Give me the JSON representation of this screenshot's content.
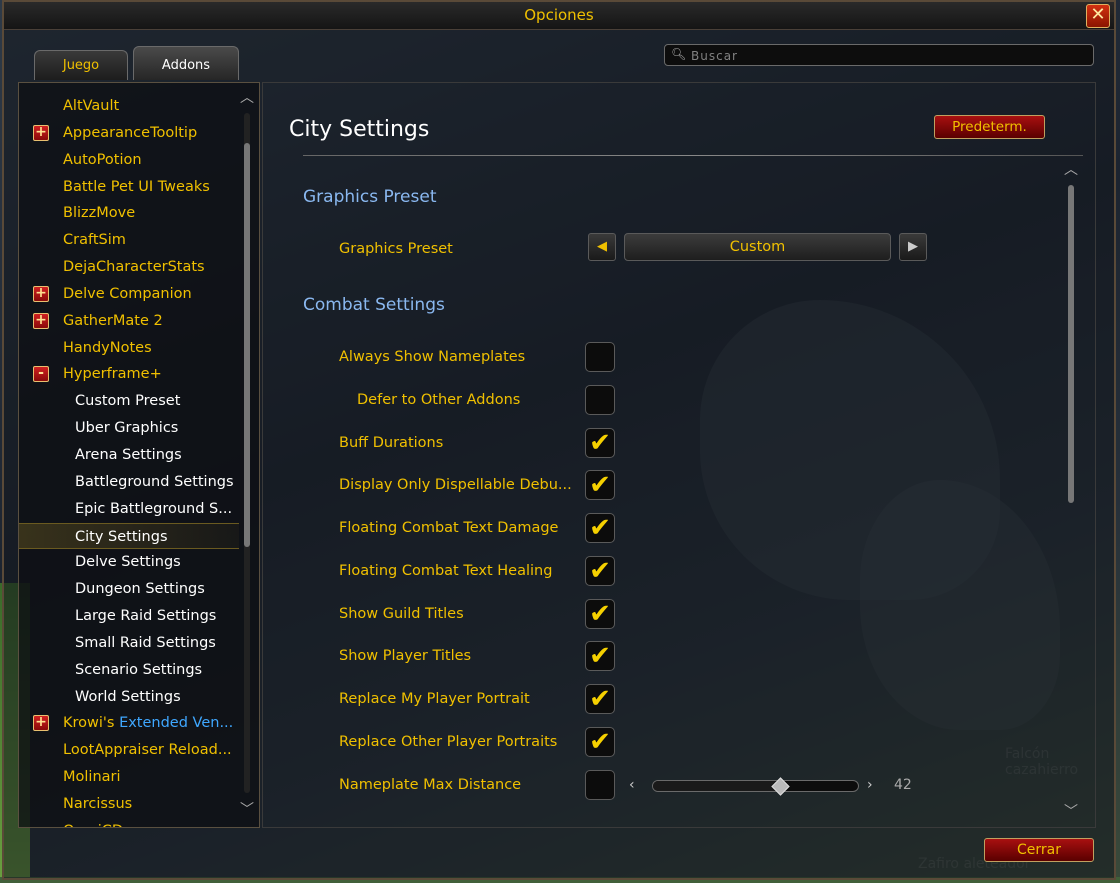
{
  "window": {
    "title": "Opciones"
  },
  "tabs": [
    {
      "label": "Juego"
    },
    {
      "label": "Addons"
    }
  ],
  "search": {
    "placeholder": "Buscar"
  },
  "sidebar": {
    "items": [
      {
        "label": "AltVault",
        "expander": ""
      },
      {
        "label": "AppearanceTooltip",
        "expander": "+"
      },
      {
        "label": "AutoPotion",
        "expander": ""
      },
      {
        "label": "Battle Pet UI Tweaks",
        "expander": ""
      },
      {
        "label": "BlizzMove",
        "expander": ""
      },
      {
        "label": "CraftSim",
        "expander": ""
      },
      {
        "label": "DejaCharacterStats",
        "expander": ""
      },
      {
        "label": "Delve Companion",
        "expander": "+"
      },
      {
        "label": "GatherMate 2",
        "expander": "+"
      },
      {
        "label": "HandyNotes",
        "expander": ""
      },
      {
        "label": "Hyperframe+",
        "expander": "-"
      },
      {
        "label": "Custom Preset",
        "child": true
      },
      {
        "label": "Uber Graphics",
        "child": true
      },
      {
        "label": "Arena Settings",
        "child": true
      },
      {
        "label": "Battleground Settings",
        "child": true
      },
      {
        "label": "Epic Battleground S...",
        "child": true
      },
      {
        "label": "City Settings",
        "child": true,
        "selected": true
      },
      {
        "label": "Delve Settings",
        "child": true
      },
      {
        "label": "Dungeon Settings",
        "child": true
      },
      {
        "label": "Large Raid Settings",
        "child": true
      },
      {
        "label": "Small Raid Settings",
        "child": true
      },
      {
        "label": "Scenario Settings",
        "child": true
      },
      {
        "label": "World Settings",
        "child": true
      },
      {
        "label": "Krowi's ",
        "label_blue": "Extended Ven...",
        "expander": "+"
      },
      {
        "label": "LootAppraiser Reload...",
        "expander": ""
      },
      {
        "label": "Molinari",
        "expander": ""
      },
      {
        "label": "Narcissus",
        "expander": ""
      },
      {
        "label": "OmniCD",
        "expander": ""
      }
    ]
  },
  "main": {
    "title": "City Settings",
    "defaults_label": "Predeterm.",
    "sections": {
      "graphics": "Graphics Preset",
      "combat": "Combat Settings"
    },
    "graphics_preset": {
      "label": "Graphics Preset",
      "value": "Custom",
      "prev": "◀",
      "next": "▶"
    },
    "settings": [
      {
        "label": "Always Show Nameplates",
        "checked": false
      },
      {
        "label": "Defer to Other Addons",
        "checked": false,
        "indent": true
      },
      {
        "label": "Buff Durations",
        "checked": true
      },
      {
        "label": "Display Only Dispellable Debu...",
        "checked": true
      },
      {
        "label": "Floating Combat Text Damage",
        "checked": true
      },
      {
        "label": "Floating Combat Text Healing",
        "checked": true
      },
      {
        "label": "Show Guild Titles",
        "checked": true
      },
      {
        "label": "Show Player Titles",
        "checked": true
      },
      {
        "label": "Replace My Player Portrait",
        "checked": true
      },
      {
        "label": "Replace Other Player Portraits",
        "checked": true
      },
      {
        "label": "Nameplate Max Distance",
        "checked": false
      }
    ],
    "slider": {
      "value": "42",
      "min": 0,
      "max": 100,
      "level": 0.62,
      "left": "‹",
      "right": "›"
    },
    "checkmark": "✔"
  },
  "footer": {
    "close_label": "Cerrar"
  },
  "background": {
    "npc_1": "Falcón cazahierro",
    "npc_2": "Zafiro aleteador"
  },
  "colors": {
    "gold": "#f0c000",
    "section": "#8ab8f0",
    "button_red": "#a81010"
  }
}
